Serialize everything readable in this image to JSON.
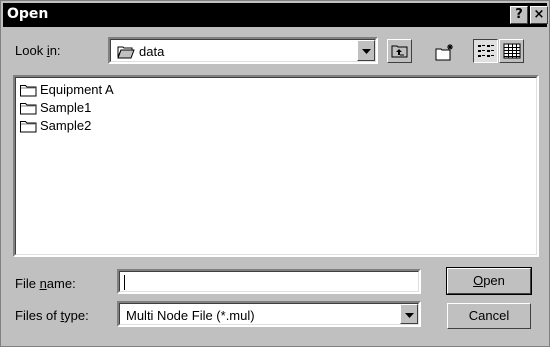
{
  "window": {
    "title": "Open",
    "help_button": "?",
    "close_button": "×"
  },
  "look_in": {
    "label_pre": "Look ",
    "label_key": "i",
    "label_post": "n:",
    "value": "data"
  },
  "toolbar": {
    "up_icon": "up-one-level-icon",
    "new_folder_icon": "new-folder-icon",
    "list_view_icon": "list-view-icon",
    "details_view_icon": "details-view-icon"
  },
  "files": [
    {
      "name": "Equipment A",
      "icon": "folder-icon"
    },
    {
      "name": "Sample1",
      "icon": "folder-icon"
    },
    {
      "name": "Sample2",
      "icon": "folder-icon"
    }
  ],
  "file_name": {
    "label_pre": "File ",
    "label_key": "n",
    "label_post": "ame:",
    "value": "",
    "placeholder": ""
  },
  "file_type": {
    "label_pre": "Files of ",
    "label_key": "t",
    "label_post": "ype:",
    "value": "Multi Node File (*.mul)"
  },
  "buttons": {
    "open_key": "O",
    "open_rest": "pen",
    "cancel": "Cancel"
  },
  "colors": {
    "face": "#c0c0c0",
    "titlebar": "#000000",
    "window": "#ffffff"
  }
}
